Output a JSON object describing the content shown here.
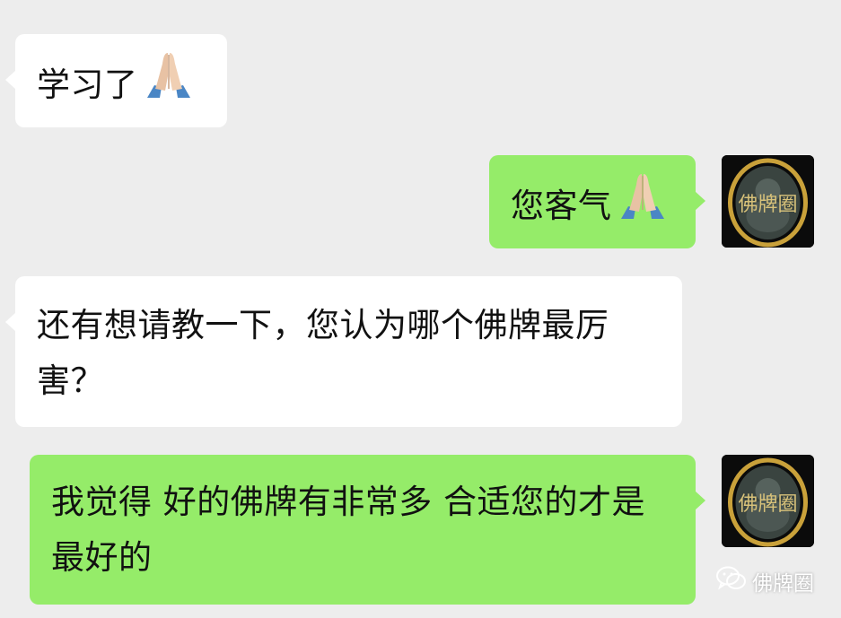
{
  "colors": {
    "background": "#ededed",
    "incoming_bubble": "#ffffff",
    "outgoing_bubble": "#95ec69",
    "text": "#111111"
  },
  "messages": [
    {
      "direction": "incoming",
      "text": "学习了",
      "icon": "praying-hands-icon"
    },
    {
      "direction": "outgoing",
      "text": "您客气",
      "icon": "praying-hands-icon"
    },
    {
      "direction": "incoming",
      "text": "还有想请教一下，您认为哪个佛牌最厉害？"
    },
    {
      "direction": "outgoing",
      "text": "我觉得 好的佛牌有非常多 合适您的才是最好的"
    }
  ],
  "avatar": {
    "label": "佛牌圈",
    "icon": "amulet-avatar-icon"
  },
  "watermark": {
    "text": "佛牌圈",
    "icon": "wechat-icon"
  }
}
